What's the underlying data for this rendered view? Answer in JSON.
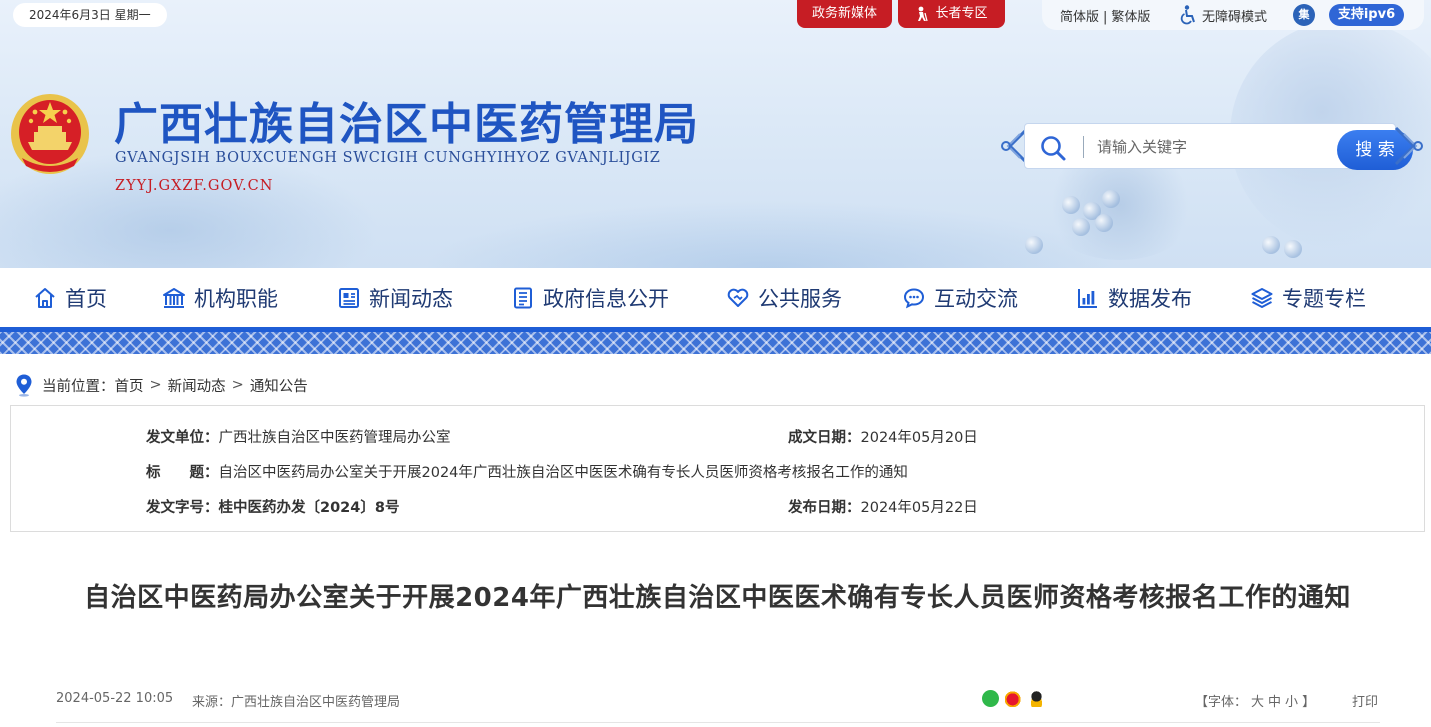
{
  "topbar": {
    "date": "2024年6月3日  星期一",
    "media_button": "政务新媒体",
    "elder_button": "长者专区",
    "lang_simplified": "简体版",
    "lang_sep": "|",
    "lang_traditional": "繁体版",
    "accessibility": "无障碍模式",
    "ipv6": "支持ipv6"
  },
  "header": {
    "title": "广西壮族自治区中医药管理局",
    "subtitle": "GVANGJSIH BOUXCUENGH SWCIGIH CUNGHYIHYOZ GVANJLIJGIZ",
    "domain": "ZYYJ.GXZF.GOV.CN"
  },
  "search": {
    "placeholder": "请输入关键字",
    "button_label": "搜 索"
  },
  "nav": {
    "items": [
      {
        "label": "首页",
        "icon": "home-icon"
      },
      {
        "label": "机构职能",
        "icon": "building-icon"
      },
      {
        "label": "新闻动态",
        "icon": "newspaper-icon"
      },
      {
        "label": "政府信息公开",
        "icon": "document-list-icon"
      },
      {
        "label": "公共服务",
        "icon": "heart-hand-icon"
      },
      {
        "label": "互动交流",
        "icon": "chat-icon"
      },
      {
        "label": "数据发布",
        "icon": "bar-chart-icon"
      },
      {
        "label": "专题专栏",
        "icon": "layers-icon"
      }
    ]
  },
  "breadcrumb": {
    "label": "当前位置：",
    "items": [
      "首页",
      "新闻动态",
      "通知公告"
    ],
    "sep": ">"
  },
  "meta": {
    "issuer_label": "发文单位：",
    "issuer": "广西壮族自治区中医药管理局办公室",
    "created_label": "成文日期：",
    "created": "2024年05月20日",
    "title_label": "标　　题：",
    "title": "自治区中医药局办公室关于开展2024年广西壮族自治区中医医术确有专长人员医师资格考核报名工作的通知",
    "docno_label": "发文字号：",
    "docno": "桂中医药办发〔2024〕8号",
    "published_label": "发布日期：",
    "published": "2024年05月22日"
  },
  "article": {
    "title": "自治区中医药局办公室关于开展2024年广西壮族自治区中医医术确有专长人员医师资格考核报名工作的通知",
    "time": "2024-05-22 10:05",
    "source_label": "来源：",
    "source": "广西壮族自治区中医药管理局",
    "fontsize_open": "【字体：",
    "font_large": "大",
    "font_medium": "中",
    "font_small": "小",
    "fontsize_close": "】",
    "print": "打印"
  },
  "colors": {
    "primary_blue": "#1f5ed6",
    "title_blue": "#1f55c2",
    "accent_red": "#c61d24"
  }
}
